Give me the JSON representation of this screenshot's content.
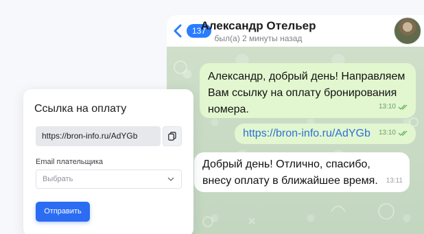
{
  "chat": {
    "back_badge": "137",
    "contact_name": "Александр Отельер",
    "contact_status": "был(а) 2 минуты назад",
    "messages": [
      {
        "direction": "out",
        "text": "Александр, добрый день! Направляем Вам ссылку на оплату бронирования номера.",
        "time": "13:10",
        "read": true
      },
      {
        "direction": "out",
        "text": "https://bron-info.ru/AdYGb",
        "time": "13:10",
        "read": true
      },
      {
        "direction": "in",
        "text": "Добрый день! Отлично, спасибо, внесу оплату в ближайшее время.",
        "time": "13:11"
      }
    ]
  },
  "payment_card": {
    "title": "Ссылка на оплату",
    "link_value": "https://bron-info.ru/AdYGb",
    "email_label": "Email плательщика",
    "select_placeholder": "Выбрать",
    "send_label": "Отправить"
  },
  "icons": {
    "back": "chevron-left-icon",
    "copy": "copy-icon",
    "select": "chevron-down-icon",
    "read": "double-check-icon"
  },
  "colors": {
    "accent": "#2b6cf2",
    "outgoing_bubble": "#e2f7cf",
    "incoming_bubble": "#ffffff",
    "chat_background": "#c7d9c4"
  }
}
